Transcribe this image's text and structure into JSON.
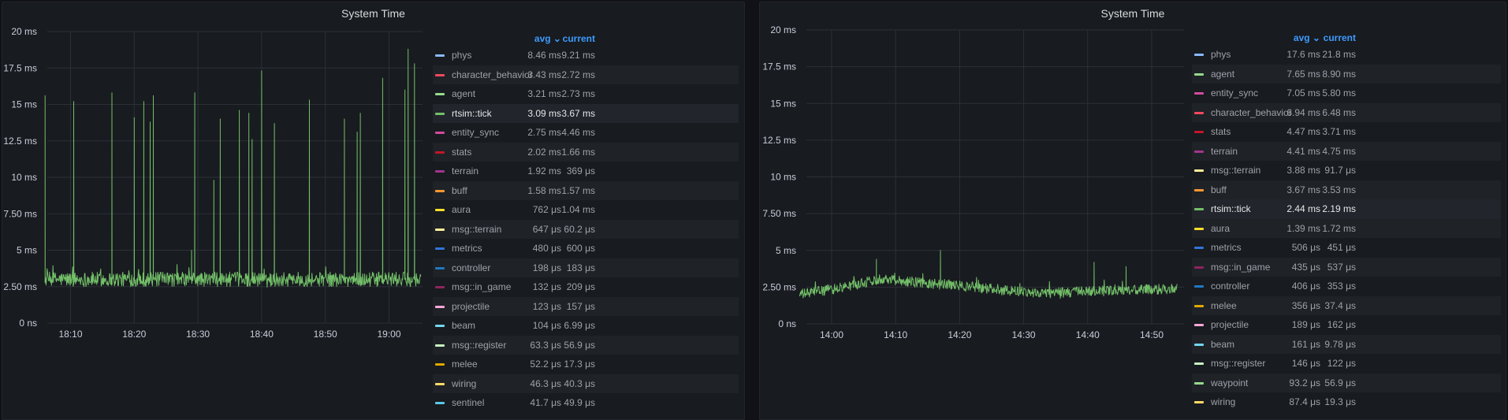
{
  "chart_data": [
    {
      "type": "line",
      "title": "System Time",
      "y_ticks": [
        "0 ns",
        "2.50 ms",
        "5 ms",
        "7.50 ms",
        "10 ms",
        "12.5 ms",
        "15 ms",
        "17.5 ms",
        "20 ms"
      ],
      "ylim": [
        0,
        20
      ],
      "x_ticks": [
        "18:10",
        "18:20",
        "18:30",
        "18:40",
        "18:50",
        "19:00"
      ],
      "x_start": "18:06",
      "x_end": "19:05",
      "series": [
        {
          "name": "rtsim::tick",
          "color": "#73bf69",
          "baseline": 3.0,
          "noise": 0.5,
          "spikes": [
            {
              "time": "18:06",
              "value": 15.6
            },
            {
              "time": "18:10.5",
              "value": 15.2
            },
            {
              "time": "18:16.5",
              "value": 15.8
            },
            {
              "time": "18:20",
              "value": 14.1
            },
            {
              "time": "18:21.5",
              "value": 15.2
            },
            {
              "time": "18:22.5",
              "value": 13.8
            },
            {
              "time": "18:23",
              "value": 15.6
            },
            {
              "time": "18:29",
              "value": 5.0
            },
            {
              "time": "18:29.5",
              "value": 15.8
            },
            {
              "time": "18:32.5",
              "value": 9.8
            },
            {
              "time": "18:33.5",
              "value": 14.0
            },
            {
              "time": "18:36.5",
              "value": 14.6
            },
            {
              "time": "18:38",
              "value": 14.4
            },
            {
              "time": "18:38.5",
              "value": 12.6
            },
            {
              "time": "18:40",
              "value": 17.3
            },
            {
              "time": "18:42",
              "value": 13.7
            },
            {
              "time": "18:47.5",
              "value": 15.3
            },
            {
              "time": "18:53",
              "value": 14.0
            },
            {
              "time": "18:55",
              "value": 13.1
            },
            {
              "time": "18:55.5",
              "value": 14.4
            },
            {
              "time": "18:59",
              "value": 16.8
            },
            {
              "time": "19:02.5",
              "value": 16.0
            },
            {
              "time": "19:03",
              "value": 18.8
            },
            {
              "time": "19:04",
              "value": 17.8
            }
          ]
        }
      ],
      "legend": {
        "placement": "right",
        "columns": [
          "avg",
          "current"
        ],
        "sort_icon": "chevron-down-icon",
        "highlighted": "rtsim::tick",
        "rows": [
          {
            "name": "phys",
            "color": "#8ab8ff",
            "avg": "8.46 ms",
            "current": "9.21 ms"
          },
          {
            "name": "character_behavior",
            "color": "#f2495c",
            "avg": "3.43 ms",
            "current": "2.72 ms"
          },
          {
            "name": "agent",
            "color": "#96d98d",
            "avg": "3.21 ms",
            "current": "2.73 ms"
          },
          {
            "name": "rtsim::tick",
            "color": "#73bf69",
            "avg": "3.09 ms",
            "current": "3.67 ms"
          },
          {
            "name": "entity_sync",
            "color": "#d44a9e",
            "avg": "2.75 ms",
            "current": "4.46 ms"
          },
          {
            "name": "stats",
            "color": "#c4162a",
            "avg": "2.02 ms",
            "current": "1.66 ms"
          },
          {
            "name": "terrain",
            "color": "#a3348f",
            "avg": "1.92 ms",
            "current": "369 μs"
          },
          {
            "name": "buff",
            "color": "#ff9830",
            "avg": "1.58 ms",
            "current": "1.57 ms"
          },
          {
            "name": "aura",
            "color": "#fade2a",
            "avg": "762 μs",
            "current": "1.04 ms"
          },
          {
            "name": "msg::terrain",
            "color": "#ffee99",
            "avg": "647 μs",
            "current": "60.2 μs"
          },
          {
            "name": "metrics",
            "color": "#3274d9",
            "avg": "480 μs",
            "current": "600 μs"
          },
          {
            "name": "controller",
            "color": "#1f78c1",
            "avg": "198 μs",
            "current": "183 μs"
          },
          {
            "name": "msg::in_game",
            "color": "#8f245e",
            "avg": "132 μs",
            "current": "209 μs"
          },
          {
            "name": "projectile",
            "color": "#ffa6d8",
            "avg": "123 μs",
            "current": "157 μs"
          },
          {
            "name": "beam",
            "color": "#73d6f2",
            "avg": "104 μs",
            "current": "6.99 μs"
          },
          {
            "name": "msg::register",
            "color": "#c8f2c2",
            "avg": "63.3 μs",
            "current": "56.9 μs"
          },
          {
            "name": "melee",
            "color": "#e0a800",
            "avg": "52.2 μs",
            "current": "17.3 μs"
          },
          {
            "name": "wiring",
            "color": "#ffd966",
            "avg": "46.3 μs",
            "current": "40.3 μs"
          },
          {
            "name": "sentinel",
            "color": "#5ac8e8",
            "avg": "41.7 μs",
            "current": "49.9 μs"
          }
        ]
      }
    },
    {
      "type": "line",
      "title": "System Time",
      "y_ticks": [
        "0 ns",
        "2.50 ms",
        "5 ms",
        "7.50 ms",
        "10 ms",
        "12.5 ms",
        "15 ms",
        "17.5 ms",
        "20 ms"
      ],
      "ylim": [
        0,
        20
      ],
      "x_ticks": [
        "14:00",
        "14:10",
        "14:20",
        "14:30",
        "14:40",
        "14:50"
      ],
      "x_start": "13:55",
      "x_end": "14:54",
      "series": [
        {
          "name": "rtsim::tick",
          "color": "#73bf69",
          "baseline_profile": [
            {
              "time": "13:55",
              "value": 2.0
            },
            {
              "time": "14:02",
              "value": 2.5
            },
            {
              "time": "14:08",
              "value": 3.1
            },
            {
              "time": "14:14",
              "value": 2.8
            },
            {
              "time": "14:20",
              "value": 2.6
            },
            {
              "time": "14:27",
              "value": 2.3
            },
            {
              "time": "14:33",
              "value": 2.1
            },
            {
              "time": "14:40",
              "value": 2.2
            },
            {
              "time": "14:47",
              "value": 2.3
            },
            {
              "time": "14:54",
              "value": 2.4
            }
          ],
          "noise": 0.35,
          "spikes": [
            {
              "time": "14:07",
              "value": 4.4
            },
            {
              "time": "14:17",
              "value": 5.0
            },
            {
              "time": "14:41",
              "value": 4.2
            },
            {
              "time": "14:46",
              "value": 3.9
            }
          ]
        }
      ],
      "legend": {
        "placement": "right",
        "columns": [
          "avg",
          "current"
        ],
        "sort_icon": "chevron-down-icon",
        "highlighted": "rtsim::tick",
        "rows": [
          {
            "name": "phys",
            "color": "#8ab8ff",
            "avg": "17.6 ms",
            "current": "21.8 ms"
          },
          {
            "name": "agent",
            "color": "#96d98d",
            "avg": "7.65 ms",
            "current": "8.90 ms"
          },
          {
            "name": "entity_sync",
            "color": "#d44a9e",
            "avg": "7.05 ms",
            "current": "5.80 ms"
          },
          {
            "name": "character_behavior",
            "color": "#f2495c",
            "avg": "6.94 ms",
            "current": "6.48 ms"
          },
          {
            "name": "stats",
            "color": "#c4162a",
            "avg": "4.47 ms",
            "current": "3.71 ms"
          },
          {
            "name": "terrain",
            "color": "#a3348f",
            "avg": "4.41 ms",
            "current": "4.75 ms"
          },
          {
            "name": "msg::terrain",
            "color": "#ffee99",
            "avg": "3.88 ms",
            "current": "91.7 μs"
          },
          {
            "name": "buff",
            "color": "#ff9830",
            "avg": "3.67 ms",
            "current": "3.53 ms"
          },
          {
            "name": "rtsim::tick",
            "color": "#73bf69",
            "avg": "2.44 ms",
            "current": "2.19 ms"
          },
          {
            "name": "aura",
            "color": "#fade2a",
            "avg": "1.39 ms",
            "current": "1.72 ms"
          },
          {
            "name": "metrics",
            "color": "#3274d9",
            "avg": "506 μs",
            "current": "451 μs"
          },
          {
            "name": "msg::in_game",
            "color": "#8f245e",
            "avg": "435 μs",
            "current": "537 μs"
          },
          {
            "name": "controller",
            "color": "#1f78c1",
            "avg": "406 μs",
            "current": "353 μs"
          },
          {
            "name": "melee",
            "color": "#e0a800",
            "avg": "356 μs",
            "current": "37.4 μs"
          },
          {
            "name": "projectile",
            "color": "#ffa6d8",
            "avg": "189 μs",
            "current": "162 μs"
          },
          {
            "name": "beam",
            "color": "#73d6f2",
            "avg": "161 μs",
            "current": "9.78 μs"
          },
          {
            "name": "msg::register",
            "color": "#c8f2c2",
            "avg": "146 μs",
            "current": "122 μs"
          },
          {
            "name": "waypoint",
            "color": "#96d98d",
            "avg": "93.2 μs",
            "current": "56.9 μs"
          },
          {
            "name": "wiring",
            "color": "#ffd966",
            "avg": "87.4 μs",
            "current": "19.3 μs"
          }
        ]
      }
    }
  ]
}
